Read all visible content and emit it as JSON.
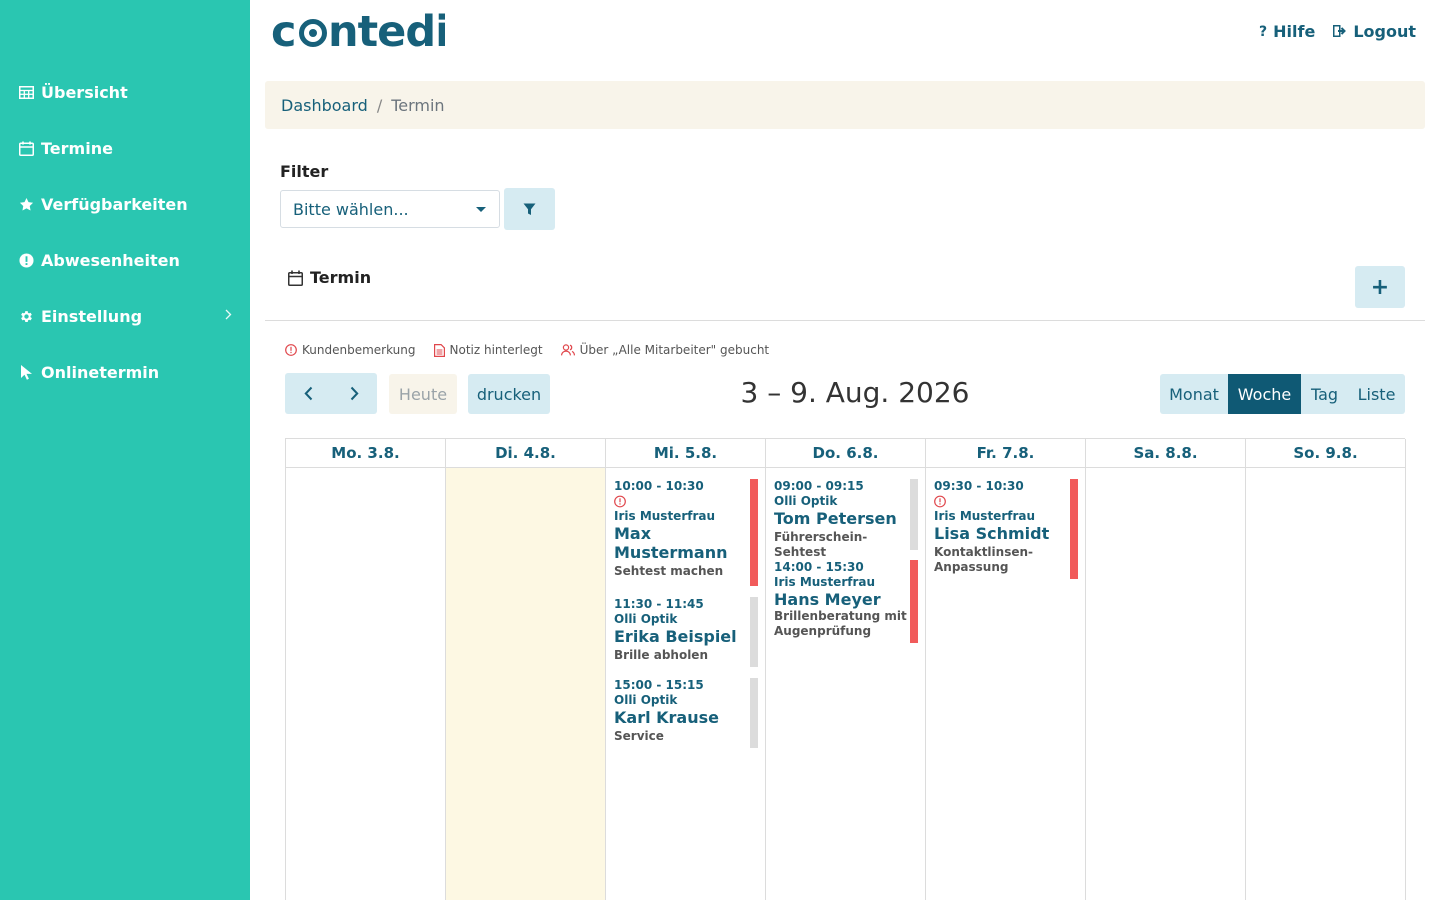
{
  "brand": {
    "logo": "contedi",
    "accent": "#2ac6b1",
    "primary": "#17607a"
  },
  "header": {
    "help_label": "Hilfe",
    "logout_label": "Logout"
  },
  "sidebar": {
    "items": [
      {
        "label": "Übersicht",
        "icon": "table-icon"
      },
      {
        "label": "Termine",
        "icon": "calendar-icon"
      },
      {
        "label": "Verfügbarkeiten",
        "icon": "star-icon"
      },
      {
        "label": "Abwesenheiten",
        "icon": "exclamation-circle-icon"
      },
      {
        "label": "Einstellung",
        "icon": "gear-icon"
      },
      {
        "label": "Onlinetermin",
        "icon": "cursor-icon"
      }
    ]
  },
  "breadcrumb": {
    "home": "Dashboard",
    "separator": "/",
    "current": "Termin"
  },
  "filter": {
    "label": "Filter",
    "placeholder": "Bitte wählen..."
  },
  "section": {
    "title": "Termin",
    "add_label": "+"
  },
  "legend": {
    "customer_remark": "Kundenbemerkung",
    "note": "Notiz hinterlegt",
    "all_staff": "Über „Alle Mitarbeiter\" gebucht"
  },
  "toolbar": {
    "today": "Heute",
    "print": "drucken",
    "title": "3 – 9. Aug. 2026",
    "views": [
      "Monat",
      "Woche",
      "Tag",
      "Liste"
    ],
    "active_view": "Woche"
  },
  "calendar": {
    "days": [
      "Mo. 3.8.",
      "Di. 4.8.",
      "Mi. 5.8.",
      "Do. 6.8.",
      "Fr. 7.8.",
      "Sa. 8.8.",
      "So. 9.8."
    ],
    "today_index": 1,
    "events": {
      "wed": [
        {
          "time": "10:00 - 10:30",
          "staff": "Iris Musterfrau",
          "name": "Max Mustermann",
          "desc": "Sehtest machen",
          "remark": true,
          "status": "red"
        },
        {
          "time": "11:30 - 11:45",
          "staff": "Olli Optik",
          "name": "Erika Beispiel",
          "desc": "Brille abholen",
          "status": "grey"
        },
        {
          "time": "15:00 - 15:15",
          "staff": "Olli Optik",
          "name": "Karl Krause",
          "desc": "Service",
          "status": "grey"
        }
      ],
      "thu": [
        {
          "time": "09:00 - 09:15",
          "staff": "Olli Optik",
          "name": "Tom Petersen",
          "desc": "Führerschein-Sehtest",
          "status": "grey"
        },
        {
          "time": "14:00 - 15:30",
          "staff": "Iris Musterfrau",
          "name": "Hans Meyer",
          "desc": "Brillenberatung mit Augenprüfung",
          "status": "red"
        }
      ],
      "fri": [
        {
          "time": "09:30 - 10:30",
          "staff": "Iris Musterfrau",
          "name": "Lisa Schmidt",
          "desc": "Kontaktlinsen-Anpassung",
          "remark": true,
          "status": "red"
        }
      ]
    }
  }
}
